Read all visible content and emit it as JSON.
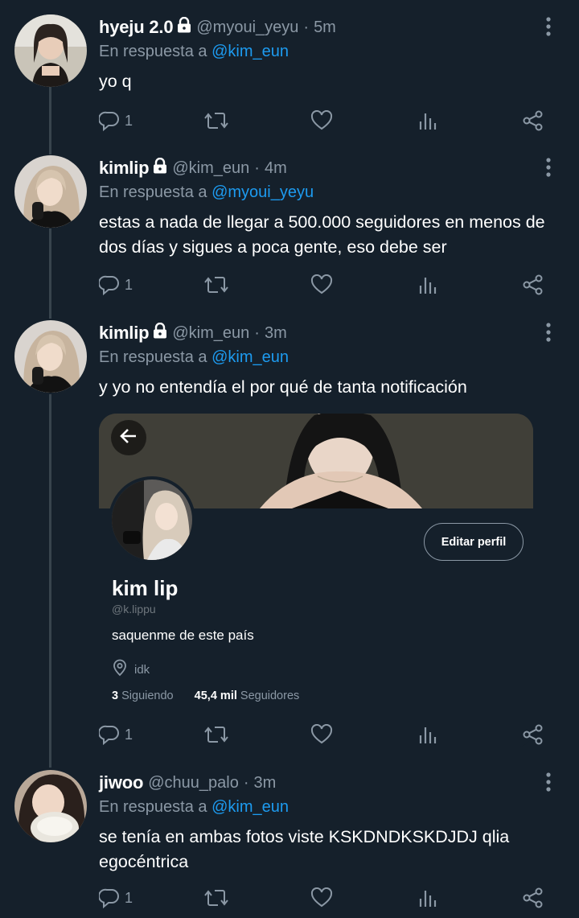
{
  "tweets": [
    {
      "name": "hyeju 2.0",
      "handle": "@myoui_yeyu",
      "time": "5m",
      "reply_prefix": "En respuesta a",
      "reply_to": "@kim_eun",
      "text": "yo q",
      "replies": "1"
    },
    {
      "name": "kimlip",
      "handle": "@kim_eun",
      "time": "4m",
      "reply_prefix": "En respuesta a",
      "reply_to": "@myoui_yeyu",
      "text": "estas a nada de llegar a 500.000 seguidores en menos de dos días y sigues a poca gente, eso debe ser",
      "replies": "1"
    },
    {
      "name": "kimlip",
      "handle": "@kim_eun",
      "time": "3m",
      "reply_prefix": "En respuesta a",
      "reply_to": "@kim_eun",
      "text": "y yo no entendía el por qué de tanta notificación",
      "replies": "1",
      "embed": {
        "edit_label": "Editar perfil",
        "profile_name": "kim lip",
        "profile_handle": "@k.lippu",
        "bio": "saquenme de este país",
        "location": "idk",
        "following_count": "3",
        "following_label": "Siguiendo",
        "followers_count": "45,4 mil",
        "followers_label": "Seguidores"
      }
    },
    {
      "name": "jiwoo",
      "handle": "@chuu_palo",
      "time": "3m",
      "reply_prefix": "En respuesta a",
      "reply_to": "@kim_eun",
      "text": "se tenía en ambas fotos viste KSKDNDKSKDJDJ qlia egocéntrica",
      "replies": "1"
    }
  ],
  "separator": "·",
  "colors": {
    "background": "#15202b",
    "secondary_text": "#8b98a5",
    "link": "#1d9bf0",
    "thread_line": "#38444d"
  },
  "icons": [
    "lock-icon",
    "more-icon",
    "reply-icon",
    "retweet-icon",
    "like-icon",
    "views-icon",
    "share-icon",
    "back-arrow-icon",
    "location-icon"
  ]
}
